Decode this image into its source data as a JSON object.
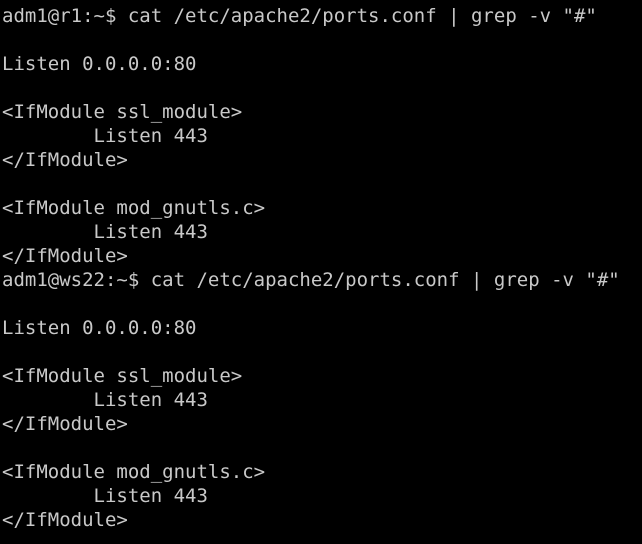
{
  "terminal": {
    "background": "#000000",
    "foreground": "#c9c9c9",
    "lines": [
      "adm1@r1:~$ cat /etc/apache2/ports.conf | grep -v \"#\"",
      "",
      "Listen 0.0.0.0:80",
      "",
      "<IfModule ssl_module>",
      "        Listen 443",
      "</IfModule>",
      "",
      "<IfModule mod_gnutls.c>",
      "        Listen 443",
      "</IfModule>",
      "adm1@ws22:~$ cat /etc/apache2/ports.conf | grep -v \"#\"",
      "",
      "Listen 0.0.0.0:80",
      "",
      "<IfModule ssl_module>",
      "        Listen 443",
      "</IfModule>",
      "",
      "<IfModule mod_gnutls.c>",
      "        Listen 443",
      "</IfModule>"
    ]
  }
}
